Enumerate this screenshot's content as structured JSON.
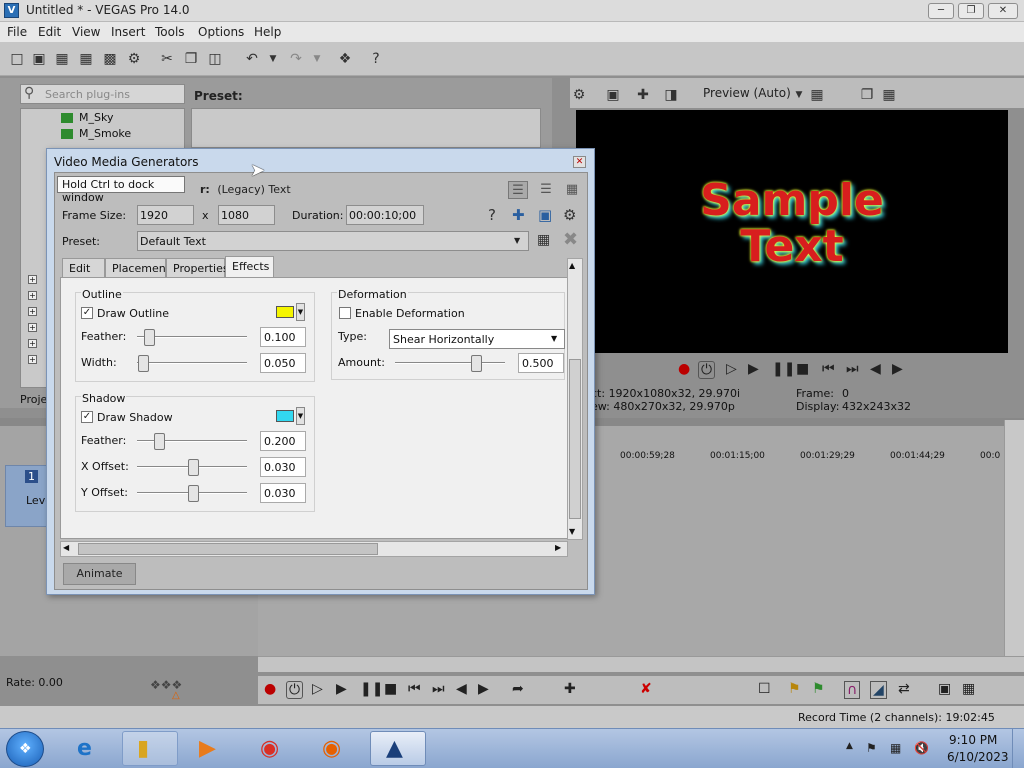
{
  "window": {
    "title": "Untitled * - VEGAS Pro 14.0",
    "app_icon": "V",
    "min": "─",
    "max": "❐",
    "close": "✕"
  },
  "menu": [
    "File",
    "Edit",
    "View",
    "Insert",
    "Tools",
    "Options",
    "Help"
  ],
  "toolbar_icons": [
    "new-project-icon",
    "open-icon",
    "save-icon",
    "save-as-icon",
    "properties-icon",
    "cut-icon",
    "copy-icon",
    "paste-icon",
    "undo-icon",
    "redo-icon",
    "render-icon",
    "help-icon"
  ],
  "explorer": {
    "search_placeholder": "Search plug-ins",
    "preset_header": "Preset:",
    "tree_items": [
      "M_Sky",
      "M_Smoke"
    ],
    "project_tab": "Proje"
  },
  "preview": {
    "quality_label": "Preview (Auto)",
    "sample_line1": "Sample",
    "sample_line2": "Text",
    "info_left_1": "ct:  1920x1080x32, 29.970i",
    "info_left_2": "ew:  480x270x32, 29.970p",
    "info_frame_label": "Frame:",
    "info_frame_value": "0",
    "info_display_label": "Display:",
    "info_display_value": "432x243x32"
  },
  "timeline": {
    "ruler": [
      "00:00:59;28",
      "00:01:15;00",
      "00:01:29;29",
      "00:01:44;29",
      "00:0"
    ],
    "track_label": "Leve",
    "track_num": "1",
    "rate": "Rate: 0.00",
    "record_time": "Record Time (2 channels): 19:02:45"
  },
  "dialog": {
    "title": "Video Media Generators",
    "tooltip": "Hold Ctrl to dock window",
    "generator_prefix": "r:",
    "generator_name": "(Legacy) Text",
    "frame_size_label": "Frame Size:",
    "frame_width": "1920",
    "frame_x": "x",
    "frame_height": "1080",
    "duration_label": "Duration:",
    "duration_value": "00:00:10;00",
    "preset_label": "Preset:",
    "preset_value": "Default Text",
    "tabs": [
      "Edit",
      "Placement",
      "Properties",
      "Effects"
    ],
    "outline": {
      "group": "Outline",
      "draw_label": "Draw Outline",
      "draw_checked": true,
      "color": "#f5f500",
      "feather_label": "Feather:",
      "feather_value": "0.100",
      "width_label": "Width:",
      "width_value": "0.050"
    },
    "deformation": {
      "group": "Deformation",
      "enable_label": "Enable Deformation",
      "enable_checked": false,
      "type_label": "Type:",
      "type_value": "Shear Horizontally",
      "amount_label": "Amount:",
      "amount_value": "0.500"
    },
    "shadow": {
      "group": "Shadow",
      "draw_label": "Draw Shadow",
      "draw_checked": true,
      "color": "#32d8f0",
      "feather_label": "Feather:",
      "feather_value": "0.200",
      "xoffset_label": "X Offset:",
      "xoffset_value": "0.030",
      "yoffset_label": "Y Offset:",
      "yoffset_value": "0.030"
    },
    "animate_label": "Animate"
  },
  "taskbar": {
    "time": "9:10 PM",
    "date": "6/10/2023"
  }
}
